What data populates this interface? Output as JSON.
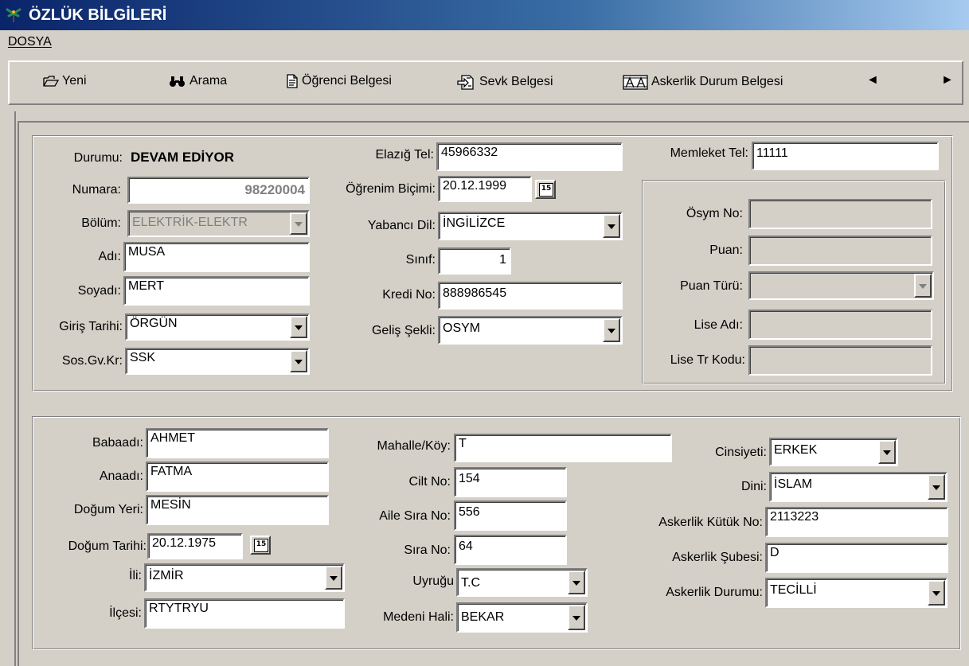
{
  "window": {
    "title": "ÖZLÜK BİLGİLERİ"
  },
  "menu": {
    "file": "DOSYA"
  },
  "toolbar": {
    "new": "Yeni",
    "search": "Arama",
    "student_cert": "Öğrenci Belgesi",
    "referral_cert": "Sevk Belgesi",
    "military_cert": "Askerlik Durum Belgesi",
    "prev": "◄",
    "next": "►"
  },
  "top": {
    "status_label": "Durumu:",
    "status_value": "DEVAM EDİYOR",
    "number_label": "Numara:",
    "number_value": "98220004",
    "dept_label": "Bölüm:",
    "dept_value": "ELEKTRİK-ELEKTR",
    "name_label": "Adı:",
    "name_value": "MUSA",
    "surname_label": "Soyadı:",
    "surname_value": "MERT",
    "entry_label": "Giriş Tarihi:",
    "entry_value": "ÖRGÜN",
    "social_label": "Sos.Gv.Kr:",
    "social_value": "SSK",
    "city_tel_label": "Elazığ Tel:",
    "city_tel_value": "45966332",
    "edu_label": "Öğrenim Biçimi:",
    "edu_value": "20.12.1999",
    "lang_label": "Yabancı Dil:",
    "lang_value": "İNGİLİZCE",
    "class_label": "Sınıf:",
    "class_value": "1",
    "credit_label": "Kredi No:",
    "credit_value": "888986545",
    "arrival_label": "Geliş Şekli:",
    "arrival_value": "OSYM",
    "home_tel_label": "Memleket Tel:",
    "home_tel_value": "11111",
    "osym_label": "Ösym No:",
    "score_label": "Puan:",
    "score_type_label": "Puan Türü:",
    "school_label": "Lise Adı:",
    "school_code_label": "Lise Tr Kodu:"
  },
  "bottom": {
    "father_label": "Babaadı:",
    "father_value": "AHMET",
    "mother_label": "Anaadı:",
    "mother_value": "FATMA",
    "birthplace_label": "Doğum Yeri:",
    "birthplace_value": "MESİN",
    "birthdate_label": "Doğum Tarihi:",
    "birthdate_value": "20.12.1975",
    "province_label": "İli:",
    "province_value": "İZMİR",
    "district_label": "İlçesi:",
    "district_value": "RTYTRYU",
    "village_label": "Mahalle/Köy:",
    "village_value": "T",
    "volume_label": "Cilt No:",
    "volume_value": "154",
    "family_label": "Aile Sıra No:",
    "family_value": "556",
    "seq_label": "Sıra No:",
    "seq_value": "64",
    "nation_label": "Uyruğu",
    "nation_value": "T.C",
    "marital_label": "Medeni Hali:",
    "marital_value": "BEKAR",
    "gender_label": "Cinsiyeti:",
    "gender_value": "ERKEK",
    "religion_label": "Dini:",
    "religion_value": "İSLAM",
    "mil_reg_label": "Askerlik Kütük No:",
    "mil_reg_value": "2113223",
    "mil_branch_label": "Askerlik Şubesi:",
    "mil_branch_value": "D",
    "mil_status_label": "Askerlik Durumu:",
    "mil_status_value": "TECİLLİ"
  },
  "calendar_icon_text": "15"
}
